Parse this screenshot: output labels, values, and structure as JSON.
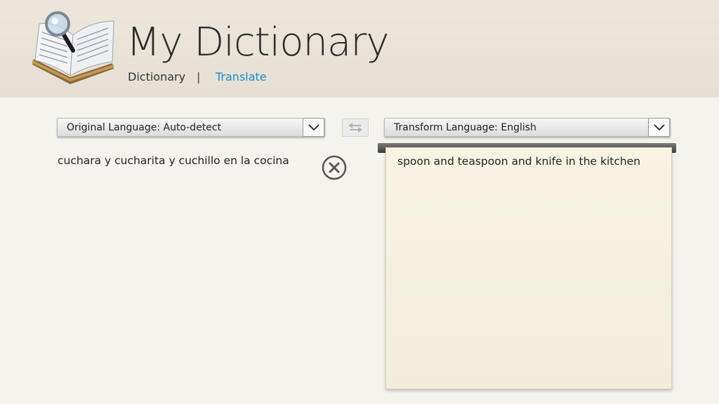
{
  "app": {
    "title": "My Dictionary"
  },
  "nav": {
    "dictionary": "Dictionary",
    "separator": "|",
    "translate": "Translate"
  },
  "translate": {
    "original_language_label": "Original Language: Auto-detect",
    "transform_language_label": "Transform Language: English",
    "input_text": "cuchara y cucharita y cuchillo en la cocina",
    "output_text": "spoon and teaspoon and knife in the kitchen"
  },
  "icons": {
    "logo": "dictionary-book-magnifier-icon",
    "dropdown": "chevron-down-icon",
    "swap": "swap-arrows-icon",
    "clear": "clear-circle-x-icon"
  },
  "colors": {
    "accent": "#1b8bd1",
    "header_bg": "#e8e1d6",
    "page_bg": "#f5f3ee",
    "paper_bg": "#f5f0df"
  }
}
